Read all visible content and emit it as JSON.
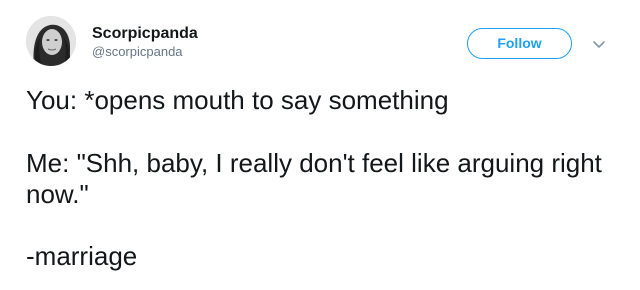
{
  "tweet": {
    "author": {
      "display_name": "Scorpicpanda",
      "handle": "@scorpicpanda",
      "avatar_icon": "user-avatar-photo"
    },
    "follow_label": "Follow",
    "more_icon": "chevron-down-icon",
    "text": {
      "line1": "You: *opens mouth to say something",
      "line2": "Me: \"Shh, baby, I really don't feel like arguing right now.\"",
      "line3": "-marriage"
    }
  },
  "colors": {
    "accent": "#1da1f2",
    "text": "#14171a",
    "secondary_text": "#657786"
  }
}
